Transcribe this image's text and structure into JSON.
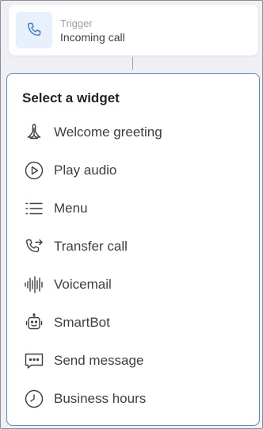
{
  "trigger": {
    "kicker": "Trigger",
    "title": "Incoming call",
    "icon": "phone-icon"
  },
  "panel": {
    "title": "Select a widget",
    "accent_color": "#4f8fdd",
    "items": [
      {
        "label": "Welcome greeting",
        "icon": "praying-hands-icon"
      },
      {
        "label": "Play audio",
        "icon": "play-circle-icon"
      },
      {
        "label": "Menu",
        "icon": "list-icon"
      },
      {
        "label": "Transfer call",
        "icon": "phone-forward-icon"
      },
      {
        "label": "Voicemail",
        "icon": "waveform-icon"
      },
      {
        "label": "SmartBot",
        "icon": "robot-icon"
      },
      {
        "label": "Send message",
        "icon": "message-bubble-icon"
      },
      {
        "label": "Business hours",
        "icon": "clock-icon"
      }
    ]
  }
}
